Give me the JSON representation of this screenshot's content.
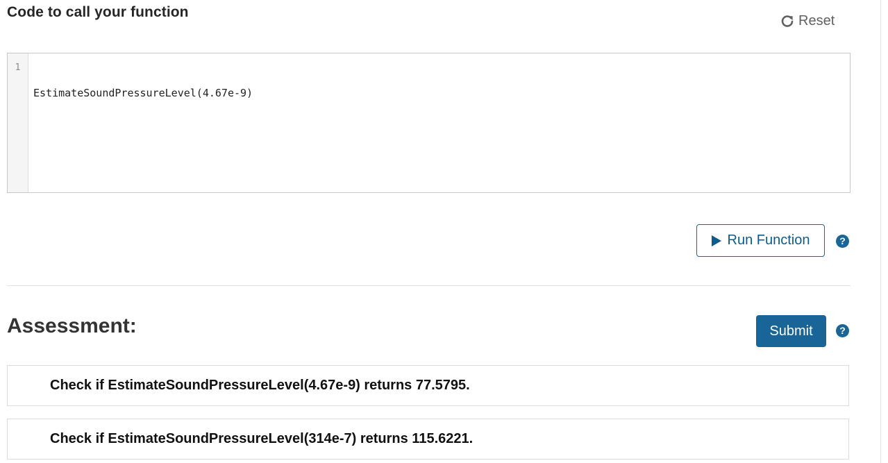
{
  "header": {
    "title": "Code to call your function",
    "reset_label": "Reset"
  },
  "editor": {
    "line_numbers": [
      "1"
    ],
    "lines": [
      "EstimateSoundPressureLevel(4.67e-9)"
    ]
  },
  "actions": {
    "run_label": "Run Function",
    "help_glyph": "?"
  },
  "assessment": {
    "title": "Assessment:",
    "submit_label": "Submit",
    "help_glyph": "?",
    "checks": [
      "Check if EstimateSoundPressureLevel(4.67e-9) returns 77.5795.",
      "Check if EstimateSoundPressureLevel(314e-7) returns 115.6221."
    ]
  },
  "colors": {
    "accent": "#1a6598",
    "border": "#c8c8c8",
    "text": "#262626"
  },
  "icons": {
    "reset": "refresh-icon",
    "run": "play-icon",
    "help": "question-circle-icon"
  }
}
